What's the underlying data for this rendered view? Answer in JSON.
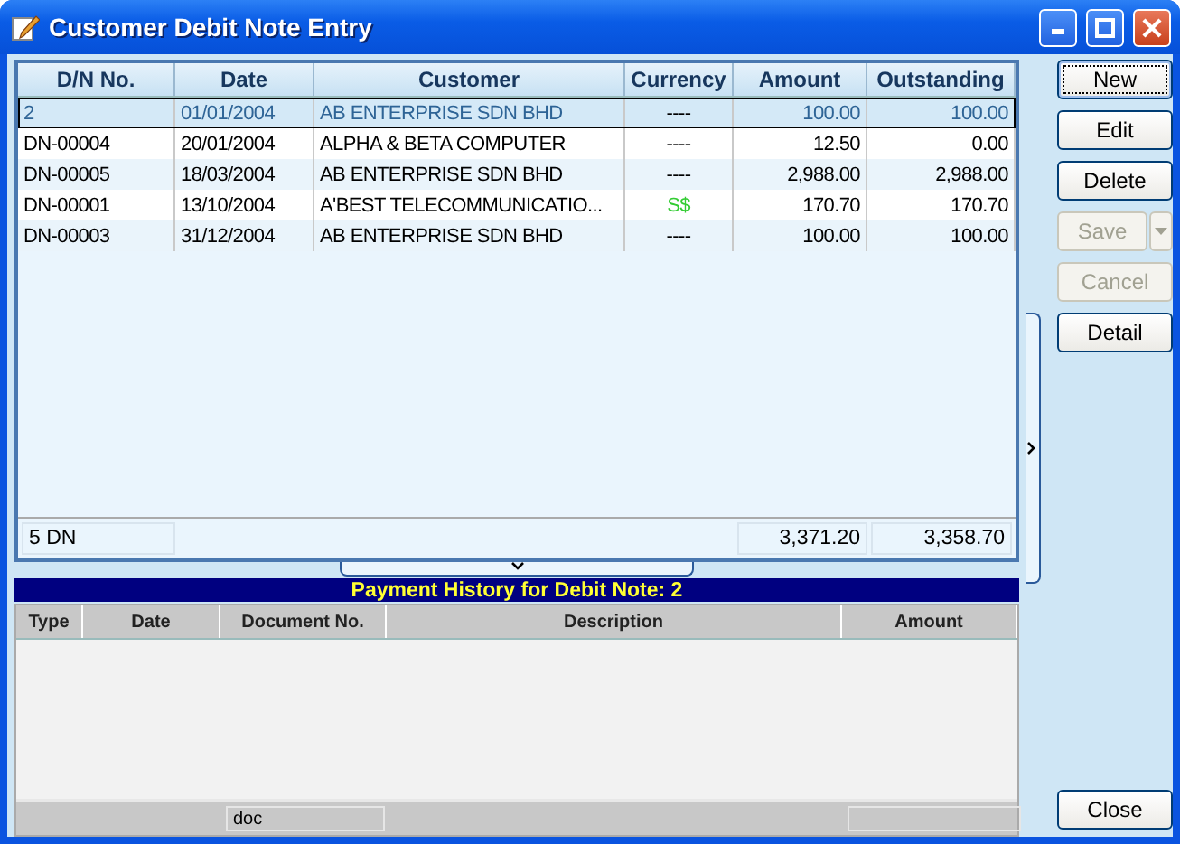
{
  "window": {
    "title": "Customer Debit Note Entry"
  },
  "debit_notes": {
    "columns": [
      "D/N No.",
      "Date",
      "Customer",
      "Currency",
      "Amount",
      "Outstanding"
    ],
    "rows": [
      {
        "dn_no": "2",
        "date": "01/01/2004",
        "customer": "AB ENTERPRISE SDN BHD",
        "currency": "----",
        "color": "#000000",
        "amount": "100.00",
        "outstanding": "100.00",
        "selected": true
      },
      {
        "dn_no": "DN-00004",
        "date": "20/01/2004",
        "customer": "ALPHA & BETA COMPUTER",
        "currency": "----",
        "color": "#000000",
        "amount": "12.50",
        "outstanding": "0.00",
        "selected": false
      },
      {
        "dn_no": "DN-00005",
        "date": "18/03/2004",
        "customer": "AB ENTERPRISE SDN BHD",
        "currency": "----",
        "color": "#000000",
        "amount": "2,988.00",
        "outstanding": "2,988.00",
        "selected": false
      },
      {
        "dn_no": "DN-00001",
        "date": "13/10/2004",
        "customer": "A'BEST TELECOMMUNICATIO...",
        "currency": "S$",
        "color": "#33cc33",
        "amount": "170.70",
        "outstanding": "170.70",
        "selected": false
      },
      {
        "dn_no": "DN-00003",
        "date": "31/12/2004",
        "customer": "AB ENTERPRISE SDN BHD",
        "currency": "----",
        "color": "#000000",
        "amount": "100.00",
        "outstanding": "100.00",
        "selected": false
      }
    ],
    "footer": {
      "count": "5 DN",
      "amount_total": "3,371.20",
      "outstanding_total": "3,358.70"
    }
  },
  "payment_history": {
    "title": "Payment History for Debit Note: 2",
    "columns": [
      "Type",
      "Date",
      "Document No.",
      "Description",
      "Amount"
    ],
    "footer": {
      "column_2": "doc"
    }
  },
  "buttons": [
    {
      "label": "New",
      "kind": "plain",
      "disabled": false,
      "focused": true
    },
    {
      "label": "Edit",
      "kind": "plain",
      "disabled": false,
      "focused": false
    },
    {
      "label": "Delete",
      "kind": "plain",
      "disabled": false,
      "focused": false
    },
    {
      "label": "Save",
      "kind": "split",
      "disabled": true,
      "focused": false
    },
    {
      "label": "Cancel",
      "kind": "plain",
      "disabled": true,
      "focused": false
    },
    {
      "label": "Detail",
      "kind": "plain",
      "disabled": false,
      "focused": false
    }
  ],
  "close_button": {
    "label": "Close"
  }
}
